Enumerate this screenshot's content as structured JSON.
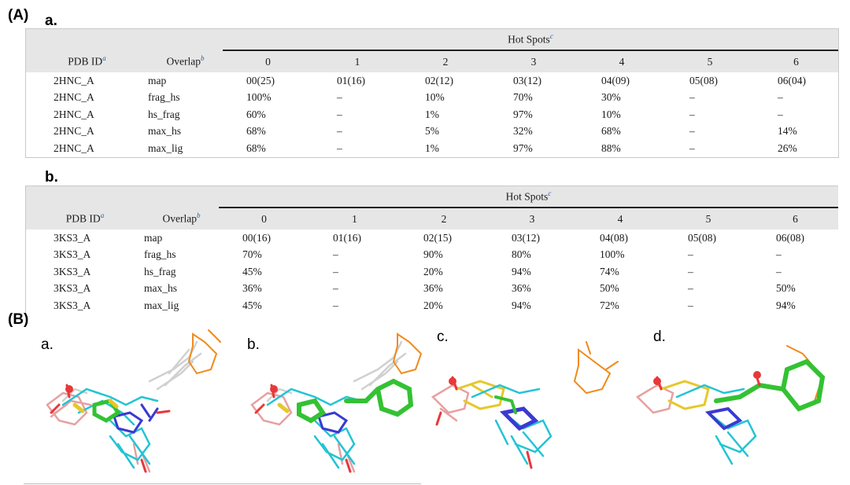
{
  "panelA_label": "(A)",
  "panelB_label": "(B)",
  "tableA": {
    "label": "a.",
    "hot_spots_title": "Hot Spots",
    "hot_spots_sup": "c",
    "pdb_header": "PDB ID",
    "pdb_sup": "a",
    "overlap_header": "Overlap",
    "overlap_sup": "b",
    "columns": [
      "0",
      "1",
      "2",
      "3",
      "4",
      "5",
      "6"
    ],
    "rows": [
      {
        "pdb": "2HNC_A",
        "overlap": "map",
        "vals": [
          "00(25)",
          "01(16)",
          "02(12)",
          "03(12)",
          "04(09)",
          "05(08)",
          "06(04)"
        ]
      },
      {
        "pdb": "2HNC_A",
        "overlap": "frag_hs",
        "vals": [
          "100%",
          "–",
          "10%",
          "70%",
          "30%",
          "–",
          "–"
        ]
      },
      {
        "pdb": "2HNC_A",
        "overlap": "hs_frag",
        "vals": [
          "60%",
          "–",
          "1%",
          "97%",
          "10%",
          "–",
          "–"
        ]
      },
      {
        "pdb": "2HNC_A",
        "overlap": "max_hs",
        "vals": [
          "68%",
          "–",
          "5%",
          "32%",
          "68%",
          "–",
          "14%"
        ]
      },
      {
        "pdb": "2HNC_A",
        "overlap": "max_lig",
        "vals": [
          "68%",
          "–",
          "1%",
          "97%",
          "88%",
          "–",
          "26%"
        ]
      }
    ]
  },
  "tableB": {
    "label": "b.",
    "hot_spots_title": "Hot Spots",
    "hot_spots_sup": "c",
    "pdb_header": "PDB ID",
    "pdb_sup": "a",
    "overlap_header": "Overlap",
    "overlap_sup": "b",
    "columns": [
      "0",
      "1",
      "2",
      "3",
      "4",
      "5",
      "6"
    ],
    "rows": [
      {
        "pdb": "3KS3_A",
        "overlap": "map",
        "vals": [
          "00(16)",
          "01(16)",
          "02(15)",
          "03(12)",
          "04(08)",
          "05(08)",
          "06(08)"
        ]
      },
      {
        "pdb": "3KS3_A",
        "overlap": "frag_hs",
        "vals": [
          "70%",
          "–",
          "90%",
          "80%",
          "100%",
          "–",
          "–"
        ]
      },
      {
        "pdb": "3KS3_A",
        "overlap": "hs_frag",
        "vals": [
          "45%",
          "–",
          "20%",
          "94%",
          "74%",
          "–",
          "–"
        ]
      },
      {
        "pdb": "3KS3_A",
        "overlap": "max_hs",
        "vals": [
          "36%",
          "–",
          "36%",
          "36%",
          "50%",
          "–",
          "50%"
        ]
      },
      {
        "pdb": "3KS3_A",
        "overlap": "max_lig",
        "vals": [
          "45%",
          "–",
          "20%",
          "94%",
          "72%",
          "–",
          "94%"
        ]
      }
    ]
  },
  "molecule_panels": [
    "a.",
    "b.",
    "c.",
    "d."
  ],
  "colors": {
    "cyan": "#22c4d4",
    "green": "#33c233",
    "orange": "#f08a1c",
    "red": "#e8383a",
    "blue": "#3a3ad0",
    "yellow": "#e6c82a",
    "pink": "#e8a0a0",
    "white": "#d8d8d8",
    "header_bg": "#e6e6e6",
    "superscript": "#2a5db0"
  }
}
